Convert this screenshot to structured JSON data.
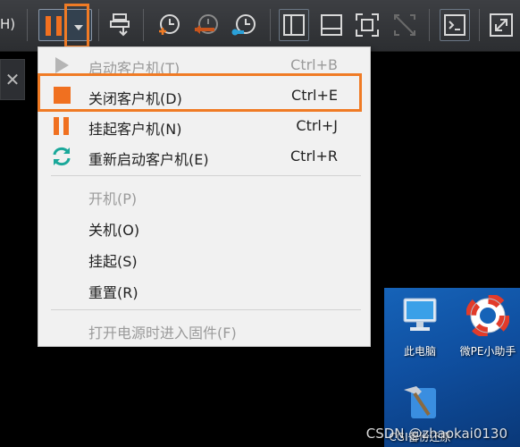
{
  "toolbar": {
    "left_text": "H)"
  },
  "side_tab": {
    "close_symbol": "✕"
  },
  "menu": {
    "items": [
      {
        "label": "启动客户机(T)",
        "shortcut": "Ctrl+B",
        "enabled": false,
        "icon": "play-icon"
      },
      {
        "label": "关闭客户机(D)",
        "shortcut": "Ctrl+E",
        "enabled": true,
        "highlighted": true,
        "icon": "stop-icon"
      },
      {
        "label": "挂起客户机(N)",
        "shortcut": "Ctrl+J",
        "enabled": true,
        "icon": "pause-icon"
      },
      {
        "label": "重新启动客户机(E)",
        "shortcut": "Ctrl+R",
        "enabled": true,
        "icon": "restart-icon"
      },
      {
        "label": "开机(P)",
        "shortcut": "",
        "enabled": false
      },
      {
        "label": "关机(O)",
        "shortcut": "",
        "enabled": true
      },
      {
        "label": "挂起(S)",
        "shortcut": "",
        "enabled": true
      },
      {
        "label": "重置(R)",
        "shortcut": "",
        "enabled": true
      },
      {
        "label": "打开电源时进入固件(F)",
        "shortcut": "",
        "enabled": false
      }
    ]
  },
  "desktop": {
    "icons": [
      {
        "label": "此电脑",
        "icon": "computer-icon"
      },
      {
        "label": "微PE小助手",
        "icon": "lifebuoy-icon"
      },
      {
        "label": "CGI备份还原",
        "icon": "hammer-icon"
      }
    ]
  },
  "watermark": "CSDN @zhaokai0130",
  "colors": {
    "accent_orange": "#f07b25",
    "menu_bg": "#f1f1f1",
    "toolbar_bg": "#2c2e31",
    "desktop_blue": "#1663b8"
  }
}
